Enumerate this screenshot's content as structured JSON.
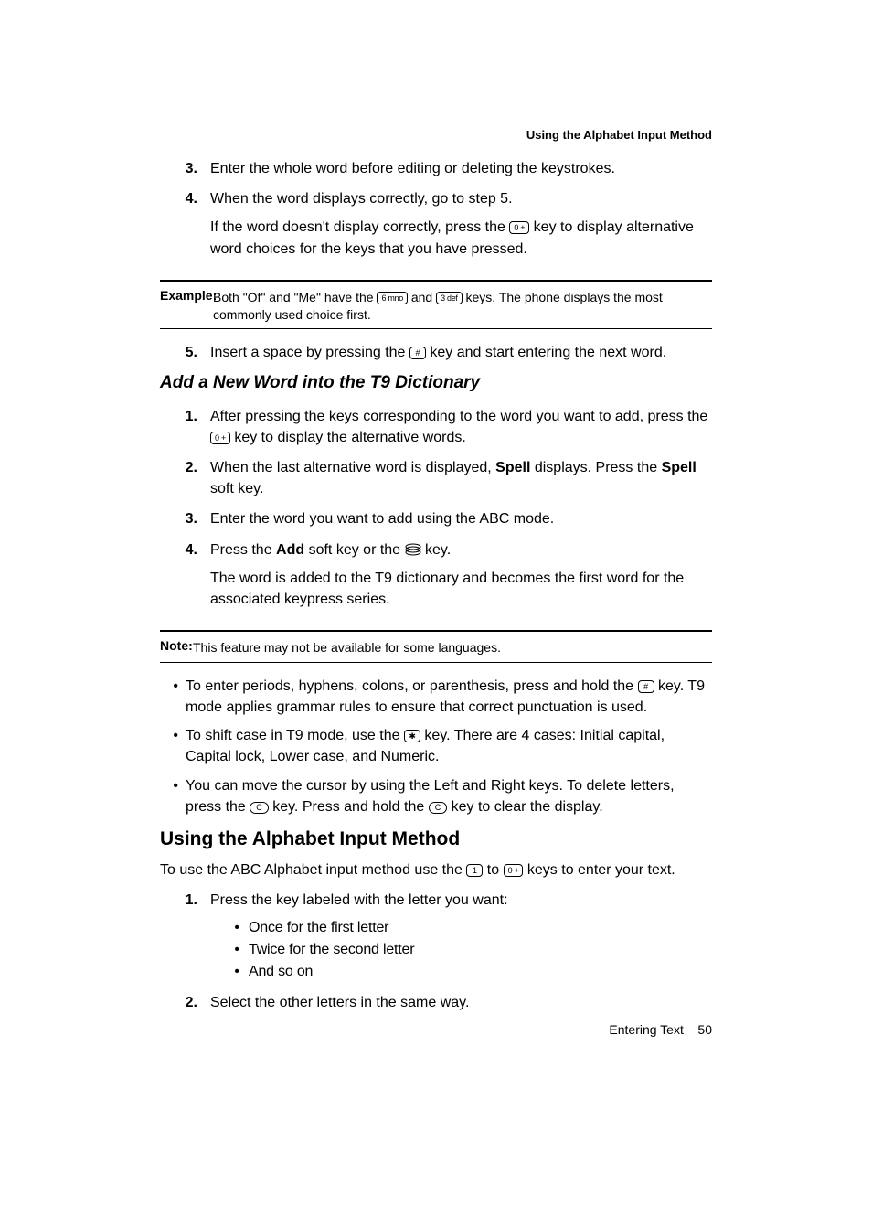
{
  "running_head": "Using the Alphabet Input Method",
  "list1": {
    "item3": {
      "num": "3.",
      "text": "Enter the whole word before editing or deleting the keystrokes."
    },
    "item4": {
      "num": "4.",
      "p1": "When the word displays correctly, go to step 5.",
      "p2a": "If the word doesn't display correctly, press the ",
      "p2b": " key to display alternative word choices for the keys that you have pressed."
    },
    "item5": {
      "num": "5.",
      "a": "Insert a space by pressing the ",
      "b": " key and start entering the next word."
    }
  },
  "example": {
    "label": "Example:",
    "a": " Both \"Of\" and \"Me\" have the ",
    "mid": " and ",
    "b": " keys. The phone displays the most commonly used choice first."
  },
  "h3": "Add a New Word into the T9 Dictionary",
  "list2": {
    "item1": {
      "num": "1.",
      "a": "After pressing the keys corresponding to the word you want to add, press the ",
      "b": " key to display the alternative words."
    },
    "item2": {
      "num": "2.",
      "a": "When the last alternative word is displayed, ",
      "spell": "Spell",
      "b": " displays. Press the ",
      "spell2": "Spell",
      "c": " soft key."
    },
    "item3": {
      "num": "3.",
      "text": "Enter the word you want to add using the ABC mode."
    },
    "item4": {
      "num": "4.",
      "a": "Press the ",
      "add": "Add",
      "b": " soft key or the ",
      "c": " key.",
      "p2": "The word is added to the T9 dictionary and becomes the first word for the associated keypress series."
    }
  },
  "note": {
    "label": "Note:",
    "text": " This feature may not be available for some languages."
  },
  "bullets": {
    "b1": {
      "a": "To enter periods, hyphens, colons, or parenthesis, press and hold the ",
      "b": " key. T9 mode applies grammar rules to ensure that correct punctuation is used."
    },
    "b2": {
      "a": "To shift case in T9 mode, use the ",
      "b": " key. There are 4 cases: Initial capital, Capital lock, Lower case, and Numeric."
    },
    "b3": {
      "a": "You can move the cursor by using the Left and Right keys. To delete letters, press the ",
      "b": " key. Press and hold the ",
      "c": " key to clear the display."
    }
  },
  "h2": "Using the Alphabet Input Method",
  "intro": {
    "a": "To use the ABC Alphabet input method use the ",
    "mid": " to ",
    "b": " keys to enter your text."
  },
  "list3": {
    "item1": {
      "num": "1.",
      "text": "Press the key labeled with the letter you want:",
      "sub1": "Once for the first letter",
      "sub2": "Twice for the second letter",
      "sub3": "And so on"
    },
    "item2": {
      "num": "2.",
      "text": "Select the other letters in the same way."
    }
  },
  "footer": {
    "section": "Entering Text",
    "page": "50"
  },
  "keys": {
    "zero": "0 +",
    "hash": "#",
    "six": "6 mno",
    "three": "3 def",
    "star": "✱",
    "c": "C",
    "one": "1"
  }
}
